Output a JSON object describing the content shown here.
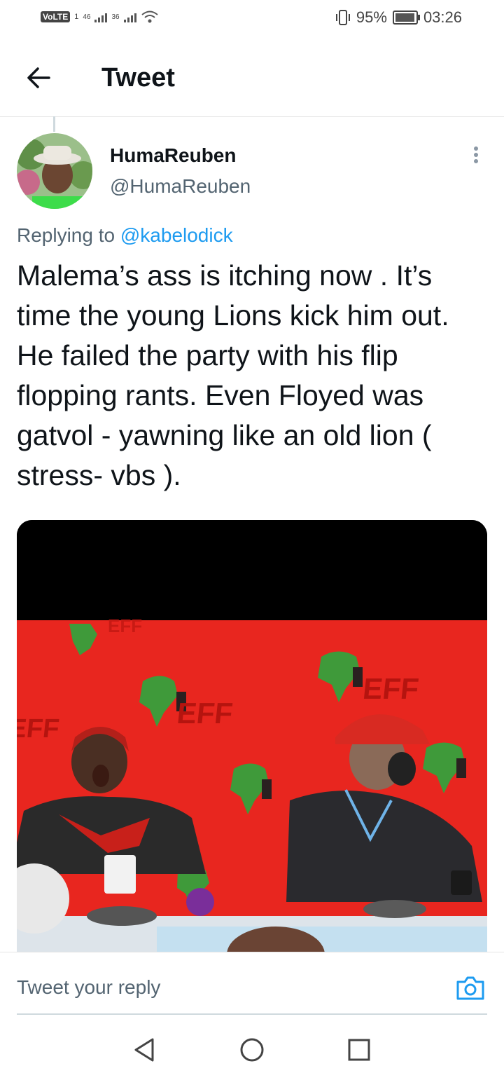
{
  "status_bar": {
    "volte": "VoLTE",
    "sim1": "1",
    "signal1": "46",
    "signal2": "36",
    "battery": "95%",
    "time": "03:26",
    "battery_level": 0.95
  },
  "header": {
    "title": "Tweet"
  },
  "tweet": {
    "author_name": "HumaReuben",
    "author_handle": "@HumaReuben",
    "replying_prefix": "Replying to",
    "replying_to": "@kabelodick",
    "text": "Malema’s ass is itching now . It’s time the young Lions kick him out. He failed the party with his flip flopping rants. Even Floyed was gatvol - yawning like an old lion ( stress- vbs ).",
    "media_text": [
      "EFF",
      "EFF",
      "EFF",
      "EFF"
    ]
  },
  "reply": {
    "placeholder": "Tweet your reply"
  },
  "icons": {
    "back": "arrow-left-icon",
    "more": "more-vertical-icon",
    "camera": "camera-icon",
    "nav_back": "triangle-back-icon",
    "nav_home": "circle-home-icon",
    "nav_recents": "square-recents-icon"
  },
  "colors": {
    "link": "#1d9bf0",
    "secondary_text": "#536471",
    "media_background": "#e8261f"
  }
}
